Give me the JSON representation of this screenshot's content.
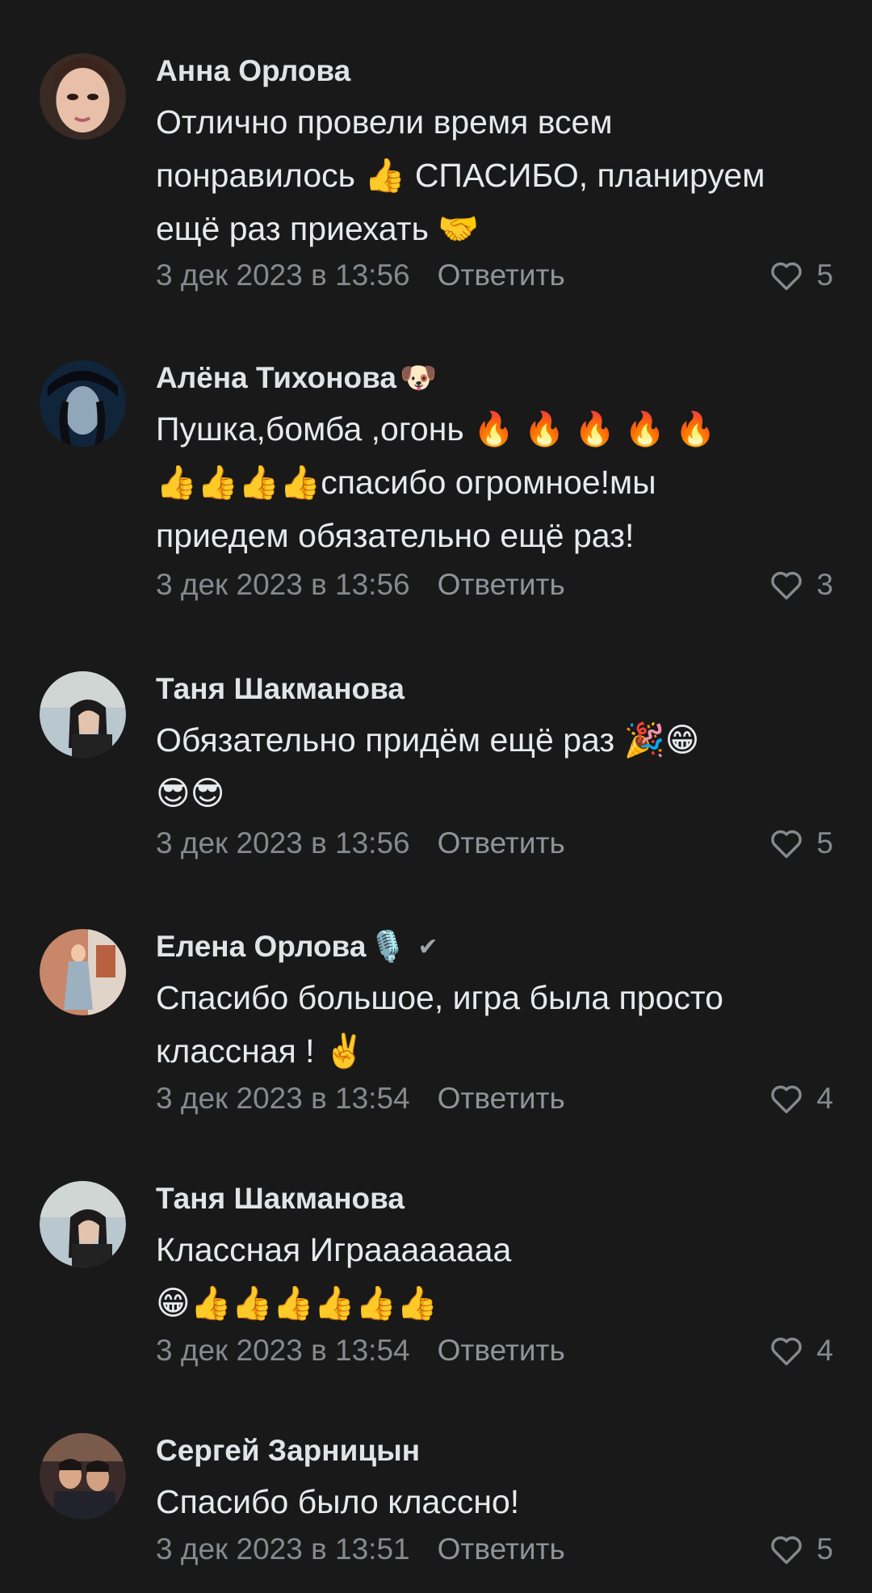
{
  "comments": [
    {
      "author": "Анна Орлова",
      "author_deco": "",
      "verified": false,
      "text": "Отлично провели время всем\nпонравилось 👍 СПАСИБО, планируем\nещё раз приехать 🤝",
      "date": "3 дек 2023 в 13:56",
      "reply_label": "Ответить",
      "likes": "5"
    },
    {
      "author": "Алёна Тихонова",
      "author_deco": "🐶",
      "verified": false,
      "text": "Пушка,бомба ,огонь 🔥 🔥 🔥 🔥 🔥\n👍👍👍👍спасибо огромное!мы\nприедем обязательно ещё раз!",
      "date": "3 дек 2023 в 13:56",
      "reply_label": "Ответить",
      "likes": "3"
    },
    {
      "author": "Таня Шакманова",
      "author_deco": "",
      "verified": false,
      "text": "Обязательно придём ещё раз 🎉😁\n😎😎",
      "date": "3 дек 2023 в 13:56",
      "reply_label": "Ответить",
      "likes": "5"
    },
    {
      "author": "Елена Орлова",
      "author_deco": "🎙️",
      "verified": true,
      "verified_mark": "✔",
      "text": "Спасибо большое, игра была просто\nклассная ! ✌️",
      "date": "3 дек 2023 в 13:54",
      "reply_label": "Ответить",
      "likes": "4"
    },
    {
      "author": "Таня Шакманова",
      "author_deco": "",
      "verified": false,
      "text": "Классная Играааааааа\n😁👍👍👍👍👍👍",
      "date": "3 дек 2023 в 13:54",
      "reply_label": "Ответить",
      "likes": "4"
    },
    {
      "author": "Сергей Зарницын",
      "author_deco": "",
      "verified": false,
      "text": "Спасибо было классно!",
      "date": "3 дек 2023 в 13:51",
      "reply_label": "Ответить",
      "likes": "5"
    }
  ],
  "colors": {
    "background": "#191919",
    "text": "#e1e3e6",
    "secondary": "#86898e"
  },
  "icons": {
    "like": "heart-outline-icon",
    "verified": "check-icon"
  }
}
